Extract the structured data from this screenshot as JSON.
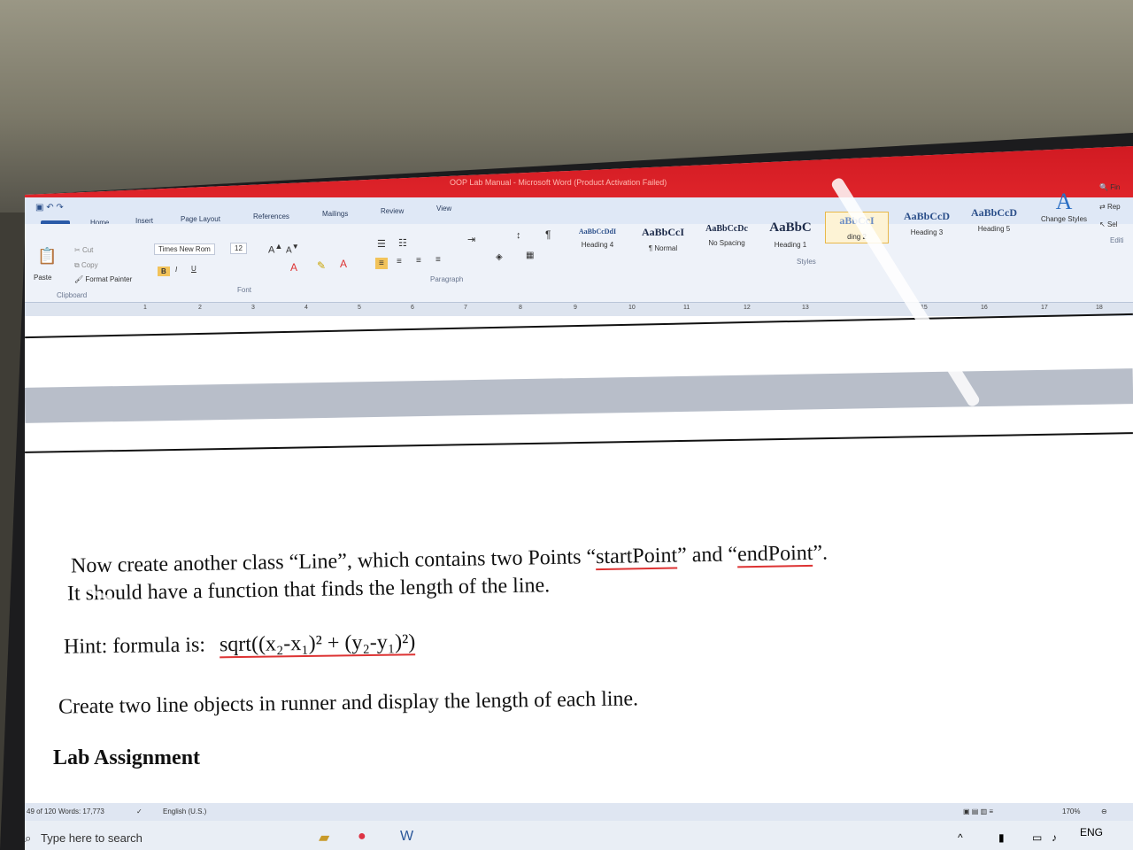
{
  "window": {
    "title": "OOP Lab Manual - Microsoft Word (Product Activation Failed)"
  },
  "quick_access": [
    "save-icon",
    "undo-icon",
    "redo-icon"
  ],
  "ribbon_tabs": [
    "File",
    "Home",
    "Insert",
    "Page Layout",
    "References",
    "Mailings",
    "Review",
    "View"
  ],
  "clipboard": {
    "paste": "Paste",
    "cut": "Cut",
    "copy": "Copy",
    "format_painter": "Format Painter",
    "group": "Clipboard"
  },
  "font": {
    "name": "Times New Rom",
    "size": "12",
    "group": "Font",
    "bold": "B",
    "italic": "I",
    "underline": "U"
  },
  "paragraph": {
    "group": "Paragraph",
    "pilcrow": "¶"
  },
  "styles": {
    "group": "Styles",
    "items": [
      {
        "sample": "AaBbCcDdI",
        "name": "Heading 4"
      },
      {
        "sample": "AaBbCcI",
        "name": "¶ Normal"
      },
      {
        "sample": "AaBbCcDc",
        "name": "No Spacing"
      },
      {
        "sample": "AaBbC",
        "name": "Heading 1"
      },
      {
        "sample": "aBbCcI",
        "name": "ding 2"
      },
      {
        "sample": "AaBbCcD",
        "name": "Heading 3"
      },
      {
        "sample": "AaBbCcD",
        "name": "Heading 5"
      }
    ],
    "change_styles": "Change Styles",
    "change_styles_glyph": "A"
  },
  "editing": {
    "find": "Fin",
    "replace": "Rep",
    "select": "Sel",
    "group": "Editi"
  },
  "ruler_numbers": [
    "1",
    "2",
    "3",
    "4",
    "5",
    "6",
    "7",
    "8",
    "9",
    "10",
    "11",
    "12",
    "13",
    "15",
    "16",
    "17",
    "18"
  ],
  "document": {
    "line1_pre": "Now create another class “Line”, which contains two Points “",
    "line1_start": "startPoint",
    "line1_mid": "” and “",
    "line1_end": "endPoint",
    "line1_post": "”.",
    "line2": "It should have a function that finds the length of the line.",
    "hint_label": "Hint: formula is:",
    "hint_formula": "sqrt((x₂-x₁)² + (y₂-y₁)²)",
    "line3": "Create two line objects in runner and display the length of each line.",
    "heading": "Lab Assignment"
  },
  "status": {
    "page": "49 of 120",
    "words": "Words: 17,773",
    "language": "English (U.S.)",
    "zoom": "170%"
  },
  "taskbar": {
    "search_placeholder": "Type here to search",
    "lang": "ENG"
  }
}
